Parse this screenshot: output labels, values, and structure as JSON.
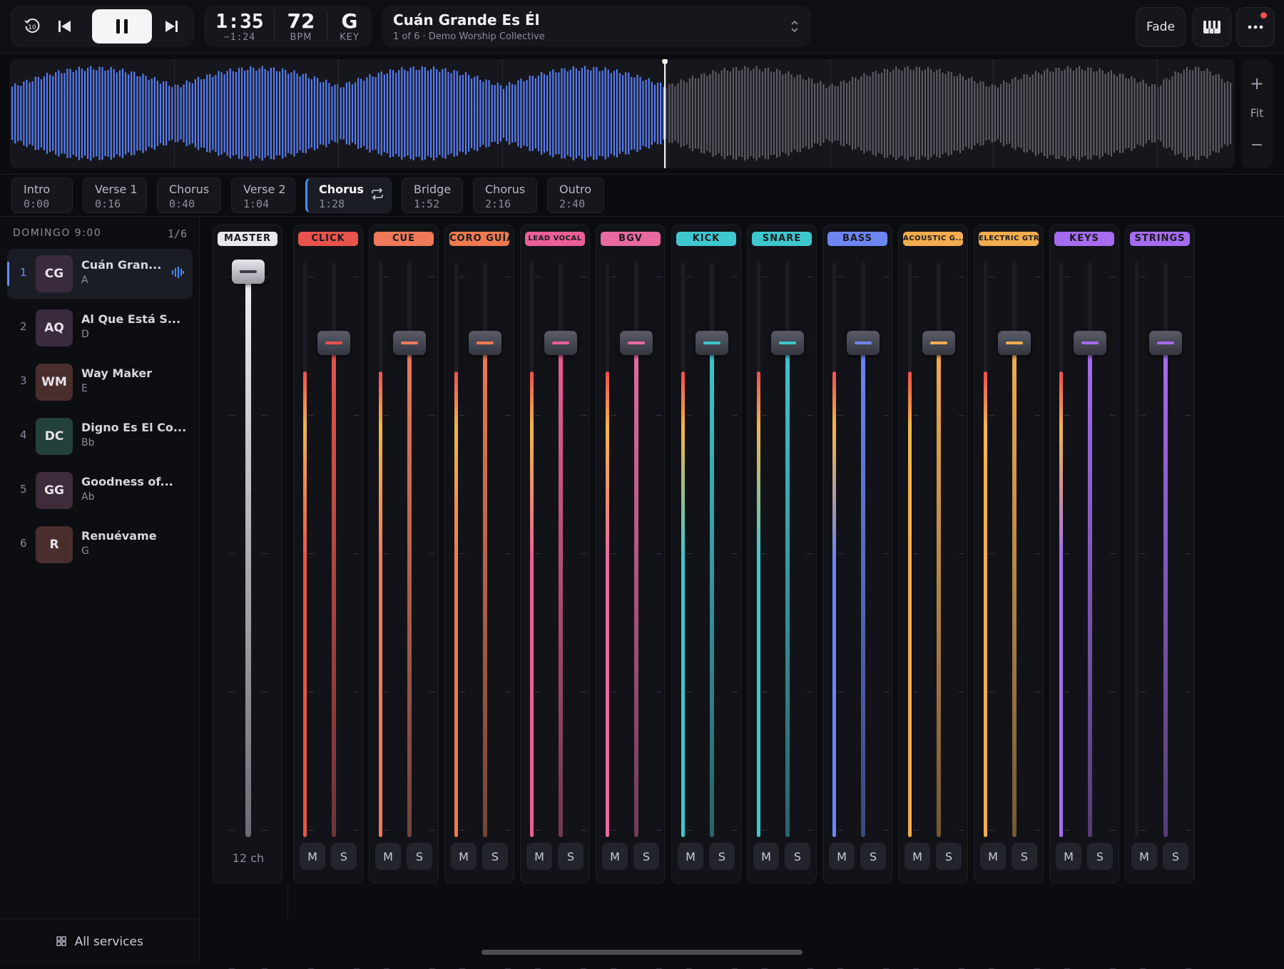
{
  "transport": {
    "time": "1:35",
    "remaining": "−1:24",
    "bpm": "72",
    "bpm_label": "BPM",
    "key": "G",
    "key_label": "KEY"
  },
  "song": {
    "title": "Cuán Grande Es Él",
    "subtitle": "1 of 6 · Demo Worship Collective"
  },
  "toolbar": {
    "fade_label": "Fade"
  },
  "zoom": {
    "fit_label": "Fit"
  },
  "playback": {
    "progress": 0.535,
    "section_boundaries": [
      0.0,
      0.134,
      0.268,
      0.402,
      0.536,
      0.67,
      0.803,
      0.937
    ]
  },
  "sections": [
    {
      "name": "Intro",
      "time": "0:00"
    },
    {
      "name": "Verse 1",
      "time": "0:16"
    },
    {
      "name": "Chorus",
      "time": "0:40"
    },
    {
      "name": "Verse 2",
      "time": "1:04"
    },
    {
      "name": "Chorus",
      "time": "1:28",
      "active": true
    },
    {
      "name": "Bridge",
      "time": "1:52"
    },
    {
      "name": "Chorus",
      "time": "2:16"
    },
    {
      "name": "Outro",
      "time": "2:40"
    }
  ],
  "setlist": {
    "title": "DOMINGO 9:00",
    "count": "1/6",
    "items": [
      {
        "num": "1",
        "initials": "CG",
        "title": "Cuán Gran...",
        "key": "A",
        "color": "#3a2b3f",
        "active": true
      },
      {
        "num": "2",
        "initials": "AQ",
        "title": "Al Que Está S...",
        "key": "D",
        "color": "#3a2b3f"
      },
      {
        "num": "3",
        "initials": "WM",
        "title": "Way Maker",
        "key": "E",
        "color": "#4a2e2e"
      },
      {
        "num": "4",
        "initials": "DC",
        "title": "Digno Es El Co...",
        "key": "Bb",
        "color": "#24403d"
      },
      {
        "num": "5",
        "initials": "GG",
        "title": "Goodness of...",
        "key": "Ab",
        "color": "#3e2c3a"
      },
      {
        "num": "6",
        "initials": "R",
        "title": "Renuévame",
        "key": "G",
        "color": "#4a2e2e"
      }
    ],
    "footer": "All services"
  },
  "mixer": {
    "master": {
      "label": "MASTER",
      "color": "#e8e9ee",
      "level": 1.0,
      "channels": "12 ch"
    },
    "mute_label": "M",
    "solo_label": "S",
    "channels": [
      {
        "label": "CLICK",
        "color": "#e8544c",
        "level": 0.86,
        "meter": 0.81
      },
      {
        "label": "CUE",
        "color": "#ef7a5a",
        "level": 0.86,
        "meter": 0.81
      },
      {
        "label": "CORO GUÍA",
        "color": "#f07a50",
        "level": 0.86,
        "meter": 0.81
      },
      {
        "label": "LEAD VOCAL",
        "color": "#ec5e97",
        "level": 0.86,
        "meter": 0.81
      },
      {
        "label": "BGV",
        "color": "#e86aa0",
        "level": 0.86,
        "meter": 0.81
      },
      {
        "label": "KICK",
        "color": "#3fc7d0",
        "level": 0.86,
        "meter": 0.81
      },
      {
        "label": "SNARE",
        "color": "#3fc7d0",
        "level": 0.86,
        "meter": 0.81
      },
      {
        "label": "BASS",
        "color": "#6d86f2",
        "level": 0.86,
        "meter": 0.81
      },
      {
        "label": "ACOUSTIC G...",
        "color": "#f3ad4f",
        "level": 0.86,
        "meter": 0.81
      },
      {
        "label": "ELECTRIC GTR",
        "color": "#f3ad4f",
        "level": 0.86,
        "meter": 0.81
      },
      {
        "label": "KEYS",
        "color": "#a56cf0",
        "level": 0.86,
        "meter": 0.81
      },
      {
        "label": "STRINGS",
        "color": "#a56cf0",
        "level": 0.86,
        "meter": 0
      }
    ]
  }
}
